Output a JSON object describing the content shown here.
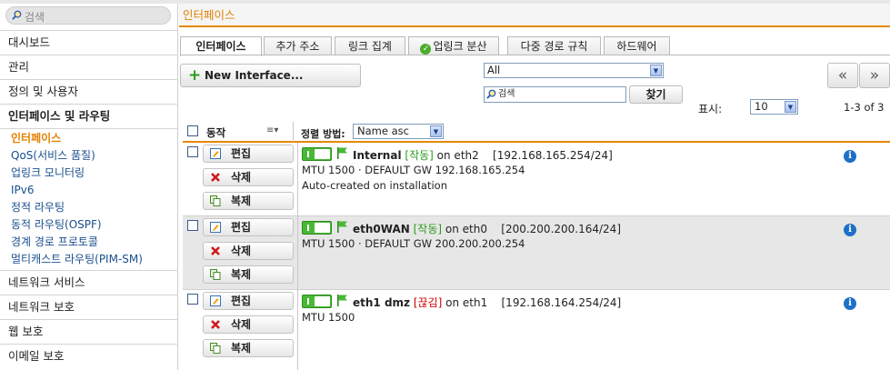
{
  "search": {
    "placeholder": "검색"
  },
  "sidebar": {
    "items": [
      {
        "label": "대시보드"
      },
      {
        "label": "관리"
      },
      {
        "label": "정의 및 사용자"
      },
      {
        "label": "인터페이스 및 라우팅"
      }
    ],
    "sub_items": [
      {
        "label": "인터페이스"
      },
      {
        "label": "QoS(서비스 품질)"
      },
      {
        "label": "업링크 모니터링"
      },
      {
        "label": "IPv6"
      },
      {
        "label": "정적 라우팅"
      },
      {
        "label": "동적 라우팅(OSPF)"
      },
      {
        "label": "경계 경로 프로토콜"
      },
      {
        "label": "멀티캐스트 라우팅(PIM-SM)"
      }
    ],
    "items_after": [
      {
        "label": "네트워크 서비스"
      },
      {
        "label": "네트워크 보호"
      },
      {
        "label": "웹 보호"
      },
      {
        "label": "이메일 보호"
      }
    ]
  },
  "main": {
    "title": "인터페이스"
  },
  "tabs": [
    {
      "label": "인터페이스"
    },
    {
      "label": "추가 주소"
    },
    {
      "label": "링크 집계"
    },
    {
      "label": "업링크 분산"
    },
    {
      "label": "다중 경로 규칙"
    },
    {
      "label": "하드웨어"
    }
  ],
  "toolbar": {
    "new_label": "New Interface...",
    "filter_value": "All",
    "search_placeholder": "검색",
    "find_label": "찾기",
    "prev_label": "«",
    "next_label": "»",
    "show_label": "표시:",
    "page_size": "10",
    "count": "1-3 of 3"
  },
  "table": {
    "action_header": "동작",
    "sort_label": "정렬 방법:",
    "sort_value": "Name asc",
    "edit_label": "편집",
    "delete_label": "삭제",
    "clone_label": "복제",
    "rows": [
      {
        "name": "Internal",
        "status": "[작동]",
        "on": "on eth2",
        "address": "[192.168.165.254/24]",
        "detail": "MTU 1500 · DEFAULT GW 192.168.165.254",
        "comment": "Auto-created on installation"
      },
      {
        "name": "eth0WAN",
        "status": "[작동]",
        "on": "on eth0",
        "address": "[200.200.200.164/24]",
        "detail": "MTU 1500 · DEFAULT GW 200.200.200.254",
        "comment": ""
      },
      {
        "name": "eth1 dmz",
        "status": "[끊김]",
        "on": "on eth1",
        "address": "[192.168.164.254/24]",
        "detail": "MTU 1500",
        "comment": ""
      }
    ]
  },
  "colors": {
    "accent": "#e48900",
    "link": "#1a4f8e",
    "up": "#2d9b1f",
    "down": "#cc0000"
  }
}
